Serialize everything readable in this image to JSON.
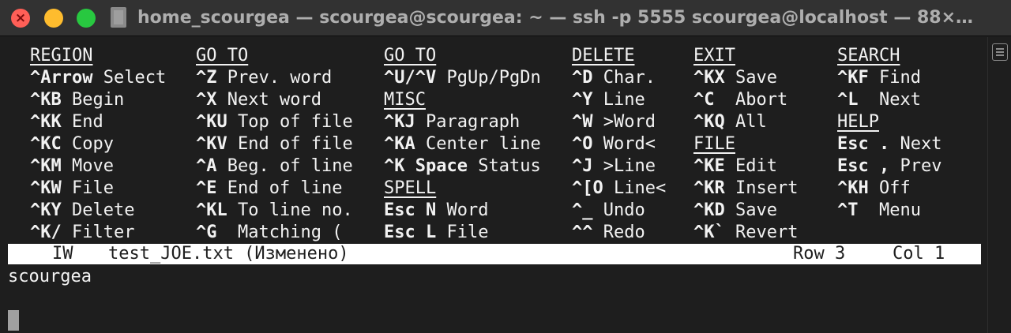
{
  "window": {
    "title": "home_scourgea — scourgea@scourgea: ~ — ssh -p 5555 scourgea@localhost — 88×…"
  },
  "help": {
    "columns": [
      {
        "header": "REGION",
        "rows": [
          {
            "key": "^Arrow",
            "desc": " Select"
          },
          {
            "key": "^KB",
            "desc": " Begin"
          },
          {
            "key": "^KK",
            "desc": " End"
          },
          {
            "key": "^KC",
            "desc": " Copy"
          },
          {
            "key": "^KM",
            "desc": " Move"
          },
          {
            "key": "^KW",
            "desc": " File"
          },
          {
            "key": "^KY",
            "desc": " Delete"
          },
          {
            "key": "^K/",
            "desc": " Filter"
          }
        ]
      },
      {
        "header": "GO TO",
        "rows": [
          {
            "key": "^Z",
            "desc": " Prev. word"
          },
          {
            "key": "^X",
            "desc": " Next word"
          },
          {
            "key": "^KU",
            "desc": " Top of file"
          },
          {
            "key": "^KV",
            "desc": " End of file"
          },
          {
            "key": "^A",
            "desc": " Beg. of line"
          },
          {
            "key": "^E",
            "desc": " End of line"
          },
          {
            "key": "^KL",
            "desc": " To line no."
          },
          {
            "key": "^G",
            "desc": "  Matching ("
          }
        ]
      },
      {
        "header": "GO TO",
        "rows": [
          {
            "key": "^U/^V",
            "desc": " PgUp/PgDn"
          },
          {
            "header": "MISC"
          },
          {
            "key": "^KJ",
            "desc": " Paragraph"
          },
          {
            "key": "^KA",
            "desc": " Center line"
          },
          {
            "key": "^K Space",
            "desc": " Status"
          },
          {
            "header": "SPELL"
          },
          {
            "key": "Esc N",
            "desc": " Word"
          },
          {
            "key": "Esc L",
            "desc": " File"
          }
        ]
      },
      {
        "header": "DELETE",
        "rows": [
          {
            "key": "^D",
            "desc": " Char."
          },
          {
            "key": "^Y",
            "desc": " Line"
          },
          {
            "key": "^W",
            "desc": " >Word"
          },
          {
            "key": "^O",
            "desc": " Word<"
          },
          {
            "key": "^J",
            "desc": " >Line"
          },
          {
            "key": "^[O",
            "desc": " Line<"
          },
          {
            "key": "^_",
            "desc": " Undo"
          },
          {
            "key": "^^",
            "desc": " Redo"
          }
        ]
      },
      {
        "header": "EXIT",
        "rows": [
          {
            "key": "^KX",
            "desc": " Save"
          },
          {
            "key": "^C",
            "desc": "  Abort"
          },
          {
            "key": "^KQ",
            "desc": " All"
          },
          {
            "header": "FILE"
          },
          {
            "key": "^KE",
            "desc": " Edit"
          },
          {
            "key": "^KR",
            "desc": " Insert"
          },
          {
            "key": "^KD",
            "desc": " Save"
          },
          {
            "key": "^K`",
            "desc": " Revert"
          }
        ]
      },
      {
        "header": "SEARCH",
        "rows": [
          {
            "key": "^KF",
            "desc": " Find"
          },
          {
            "key": "^L",
            "desc": "  Next"
          },
          {
            "header": "HELP"
          },
          {
            "key": "Esc .",
            "desc": " Next"
          },
          {
            "key": "Esc ,",
            "desc": " Prev"
          },
          {
            "key": "^KH",
            "desc": " Off"
          },
          {
            "key": "^T",
            "desc": "  Menu"
          }
        ]
      }
    ]
  },
  "status": {
    "mode": "IW",
    "filename": "test_JOE.txt (Изменено)",
    "row": "Row 3",
    "col": "Col 1"
  },
  "editor": {
    "line1": "scourgea"
  },
  "colors": {
    "background": "#1e1e1e",
    "titlebar": "#323232",
    "text": "#f2f2f2",
    "status_bar": "#ffffff",
    "close": "#ff5f57",
    "minimize": "#febc2e",
    "maximize": "#28c840"
  }
}
